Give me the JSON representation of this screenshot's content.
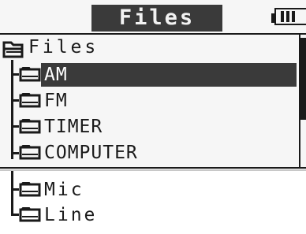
{
  "header": {
    "title": "Files"
  },
  "icons": {
    "root": "folder-open-icon",
    "item": "folder-icon",
    "battery": "battery-icon"
  },
  "tree": {
    "root_label": "Files",
    "items": [
      {
        "label": "AM",
        "selected": true
      },
      {
        "label": "FM",
        "selected": false
      },
      {
        "label": "TIMER",
        "selected": false
      },
      {
        "label": "COMPUTER",
        "selected": false
      }
    ]
  },
  "lower": {
    "items": [
      {
        "label": "Mic"
      },
      {
        "label": "Line"
      }
    ]
  },
  "colors": {
    "foreground": "#1a1a1a",
    "highlight": "#3a3a3a",
    "background": "#f6f6f6"
  }
}
